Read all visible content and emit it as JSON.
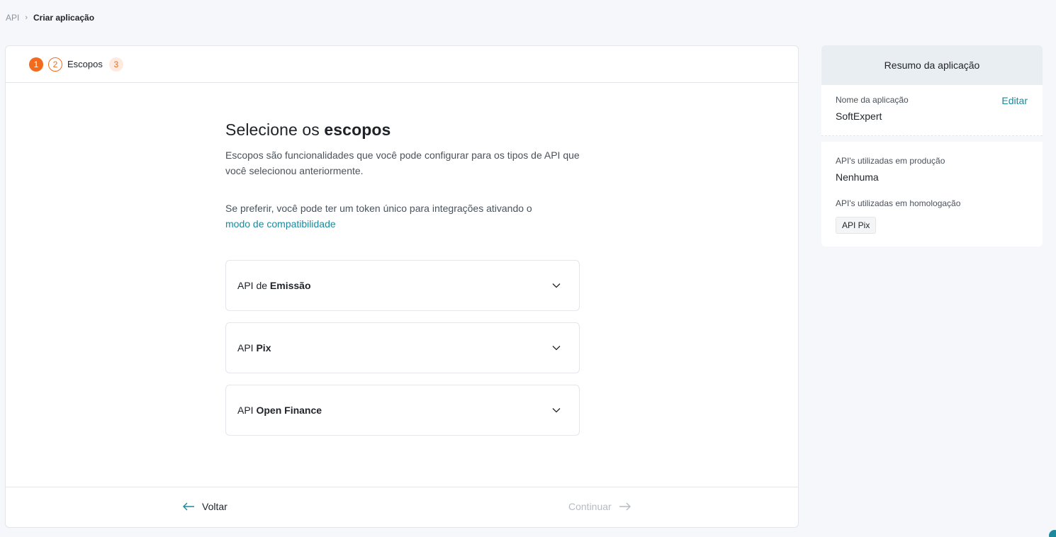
{
  "breadcrumb": {
    "root": "API",
    "separator": "›",
    "current": "Criar aplicação"
  },
  "stepper": {
    "steps": [
      {
        "number": "1",
        "label": ""
      },
      {
        "number": "2",
        "label": "Escopos"
      },
      {
        "number": "3",
        "label": ""
      }
    ],
    "accent_color": "#f26b1d"
  },
  "main": {
    "heading_regular": "Selecione os ",
    "heading_bold": "escopos",
    "description": "Escopos são funcionalidades que você pode configurar para os tipos de API que você selecionou anteriormente.",
    "compat_text": "Se preferir, você pode ter um token único para integrações ativando o",
    "compat_link": "modo de compatibilidade",
    "accordions": [
      {
        "prefix": "API de ",
        "name": "Emissão",
        "icon": "chevron-down-icon"
      },
      {
        "prefix": "API ",
        "name": "Pix",
        "icon": "chevron-down-icon"
      },
      {
        "prefix": "API ",
        "name": "Open Finance",
        "icon": "chevron-down-icon"
      }
    ]
  },
  "footer": {
    "back_label": "Voltar",
    "next_label": "Continuar",
    "link_color": "#1a8a9c"
  },
  "summary": {
    "title": "Resumo da aplicação",
    "name_label": "Nome da aplicação",
    "name_value": "SoftExpert",
    "edit_label": "Editar",
    "prod_label": "API's utilizadas em produção",
    "prod_value": "Nenhuma",
    "homolog_label": "API's utilizadas em homologação",
    "homolog_tags": [
      "API Pix"
    ]
  }
}
